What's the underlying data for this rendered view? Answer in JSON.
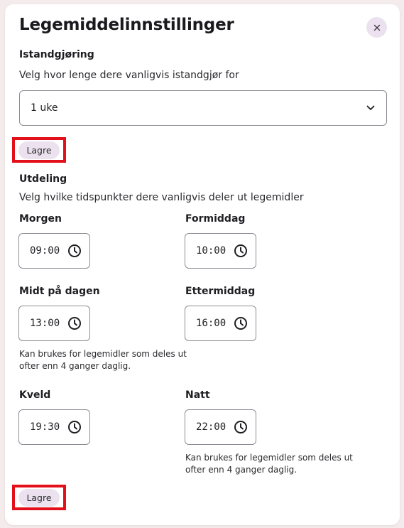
{
  "modal": {
    "title": "Legemiddelinnstillinger",
    "close_symbol": "×"
  },
  "istandgjoring": {
    "heading": "Istandgjøring",
    "description": "Velg hvor lenge dere vanligvis istandgjør for",
    "selected_value": "1 uke",
    "save_label": "Lagre"
  },
  "utdeling": {
    "heading": "Utdeling",
    "description": "Velg hvilke tidspunkter dere vanligvis deler ut legemidler",
    "times": [
      {
        "label": "Morgen",
        "value": "09:00"
      },
      {
        "label": "Formiddag",
        "value": "10:00"
      },
      {
        "label": "Midt på dagen",
        "value": "13:00"
      },
      {
        "label": "Ettermiddag",
        "value": "16:00"
      },
      {
        "label": "Kveld",
        "value": "19:30"
      },
      {
        "label": "Natt",
        "value": "22:00"
      }
    ],
    "hint_midday": "Kan brukes for legemidler som deles ut ofter enn 4 ganger daglig.",
    "hint_night": "Kan brukes for legemidler som deles ut ofter enn 4 ganger daglig.",
    "save_label": "Lagre"
  },
  "colors": {
    "background": "#f4ebec",
    "accent_light": "#ece2ef",
    "highlight_border": "#e3101b"
  }
}
